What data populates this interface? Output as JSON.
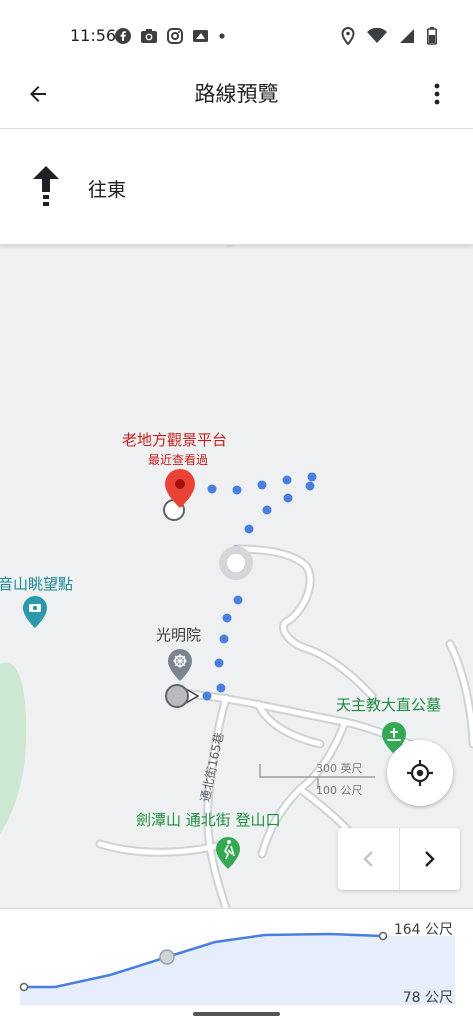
{
  "status": {
    "time": "11:56"
  },
  "header": {
    "title": "路線預覽"
  },
  "direction": {
    "text": "往東"
  },
  "map": {
    "poi_main": {
      "name": "老地方觀景平台",
      "subtitle": "最近查看過"
    },
    "poi_viewpoint": {
      "name": "音山眺望點"
    },
    "poi_temple": {
      "name": "光明院"
    },
    "poi_cemetery": {
      "name": "天主教大直公墓"
    },
    "poi_trailhead": {
      "name": "劍潭山 通北街 登山口"
    },
    "street": {
      "name": "通北街165巷"
    },
    "scale": {
      "feet": "300 英尺",
      "meters": "100 公尺"
    }
  },
  "elevation": {
    "max": "164 公尺",
    "min": "78 公尺"
  },
  "colors": {
    "route": "#4a7fe0",
    "pin": "#ea4335",
    "accent": "#4285f4"
  },
  "icons": [
    "back-arrow-icon",
    "more-vert-icon",
    "north-arrow-icon",
    "my-location-icon",
    "chevron-left-icon",
    "chevron-right-icon"
  ]
}
